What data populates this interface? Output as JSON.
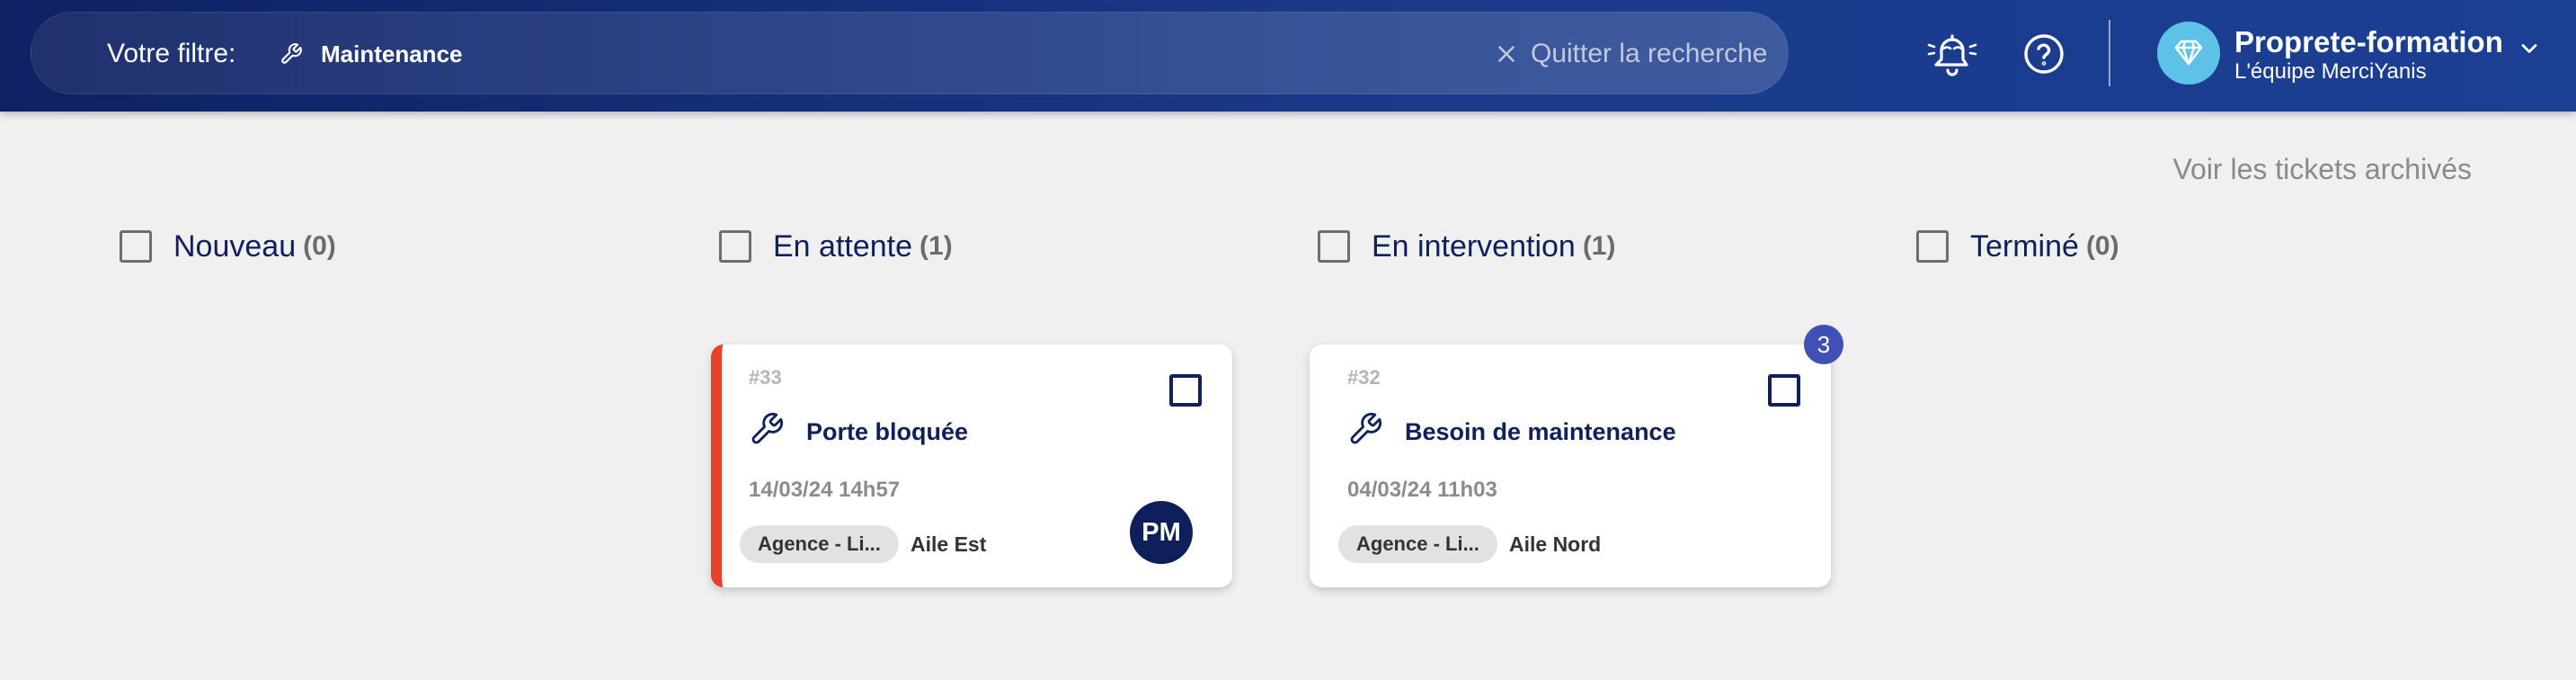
{
  "header": {
    "filter_label": "Votre filtre:",
    "filter_value": "Maintenance",
    "filter_icon": "wrench-icon",
    "quit_search_label": "Quitter la recherche",
    "notifications_icon": "bell-icon",
    "help_icon": "help-circle-icon",
    "account": {
      "org_name": "Proprete-formation",
      "team_name": "L'équipe MerciYanis",
      "logo_icon": "diamond-logo-icon"
    },
    "colors": {
      "bar_start": "#0f2163",
      "bar_end": "#1b3f93",
      "logo_bg": "#5ec2e6"
    }
  },
  "archived_link": "Voir les tickets archivés",
  "columns": [
    {
      "title": "Nouveau",
      "count": "(0)"
    },
    {
      "title": "En attente",
      "count": "(1)"
    },
    {
      "title": "En intervention",
      "count": "(1)"
    },
    {
      "title": "Terminé",
      "count": "(0)"
    }
  ],
  "cards": [
    {
      "number": "#33",
      "title": "Porte bloquée",
      "date": "14/03/24 14h57",
      "tag": "Agence - Li...",
      "location": "Aile Est",
      "assignee_initials": "PM",
      "priority_color": "#e8402c"
    },
    {
      "number": "#32",
      "title": "Besoin de maintenance",
      "date": "04/03/24 11h03",
      "tag": "Agence - Li...",
      "location": "Aile Nord",
      "badge_count": "3"
    }
  ]
}
